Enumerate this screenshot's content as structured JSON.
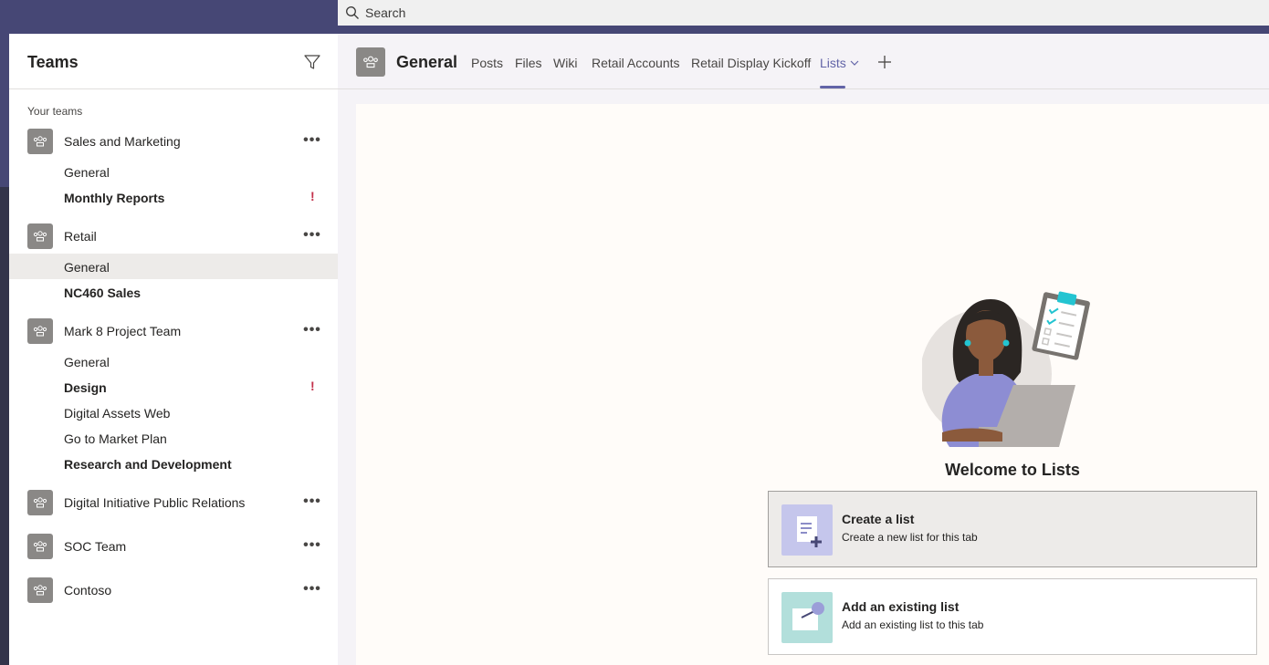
{
  "search": {
    "placeholder": "Search"
  },
  "sidebar": {
    "title": "Teams",
    "section_label": "Your teams",
    "teams": [
      {
        "name": "Sales and Marketing",
        "channels": [
          {
            "name": "General",
            "bold": false,
            "alert": false
          },
          {
            "name": "Monthly Reports",
            "bold": true,
            "alert": true
          }
        ]
      },
      {
        "name": "Retail",
        "channels": [
          {
            "name": "General",
            "bold": false,
            "alert": false,
            "selected": true
          },
          {
            "name": "NC460 Sales",
            "bold": true,
            "alert": false
          }
        ]
      },
      {
        "name": "Mark 8 Project Team",
        "channels": [
          {
            "name": "General",
            "bold": false,
            "alert": false
          },
          {
            "name": "Design",
            "bold": true,
            "alert": true
          },
          {
            "name": "Digital Assets Web",
            "bold": false,
            "alert": false
          },
          {
            "name": "Go to Market Plan",
            "bold": false,
            "alert": false
          },
          {
            "name": "Research and Development",
            "bold": true,
            "alert": false
          }
        ]
      },
      {
        "name": "Digital Initiative Public Relations",
        "channels": []
      },
      {
        "name": "SOC Team",
        "channels": []
      },
      {
        "name": "Contoso",
        "channels": []
      }
    ],
    "more_glyph": "•••",
    "alert_glyph": "!"
  },
  "header": {
    "channel_title": "General",
    "tabs": [
      "Posts",
      "Files",
      "Wiki",
      "Retail Accounts",
      "Retail Display Kickoff",
      "Lists"
    ],
    "active_tab": "Lists"
  },
  "lists": {
    "welcome": "Welcome to Lists",
    "create": {
      "title": "Create a list",
      "desc": "Create a new list for this tab"
    },
    "existing": {
      "title": "Add an existing list",
      "desc": "Add an existing list to this tab"
    }
  },
  "colors": {
    "accent": "#6264a7",
    "topbar": "#464775",
    "alert": "#c4314b"
  }
}
